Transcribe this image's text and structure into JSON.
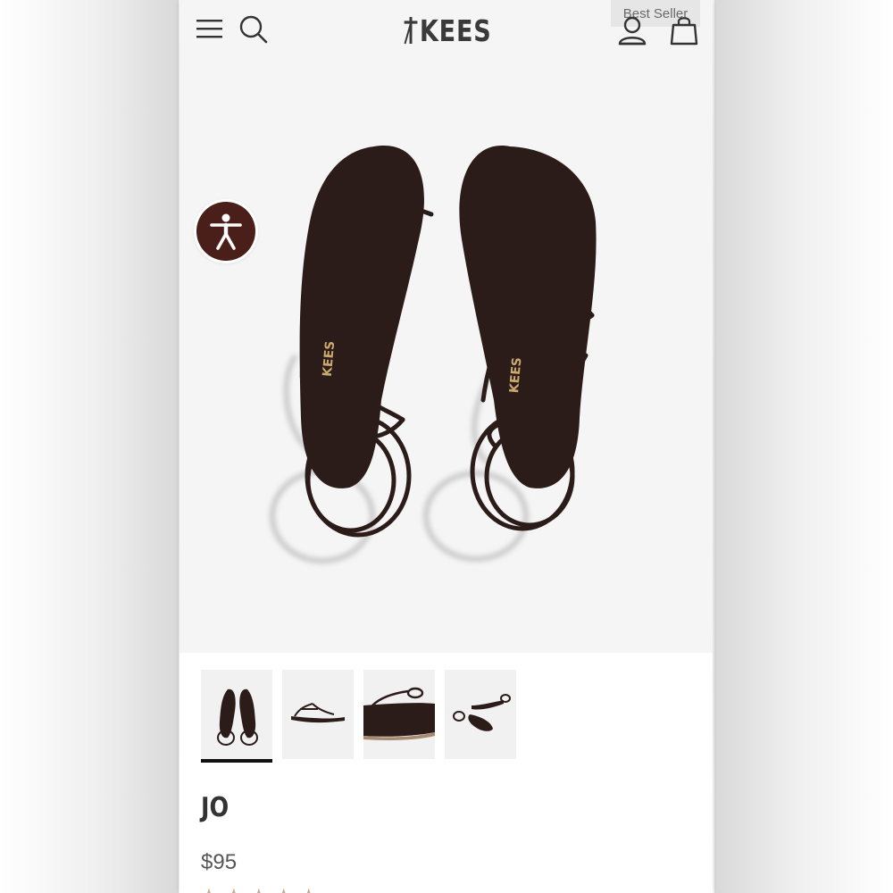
{
  "header": {
    "brand": "KEES",
    "badge": "Best Seller"
  },
  "icons": {
    "menu": "hamburger-menu-icon",
    "search": "search-icon",
    "account": "user-icon",
    "cart": "shopping-bag-icon",
    "accessibility": "accessibility-icon"
  },
  "product": {
    "name": "JO",
    "price": "$95",
    "rating_stars": "★★★★★",
    "image_count": 4,
    "selected_image": 1
  },
  "colors": {
    "accent": "#4a1f1a",
    "sandal": "#2b1c19",
    "background": "#f5f5f5"
  }
}
